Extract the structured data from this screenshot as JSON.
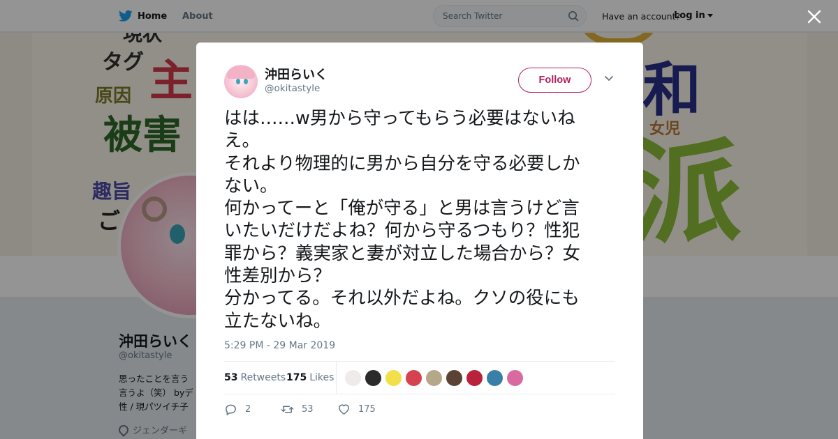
{
  "topbar": {
    "nav": {
      "home": "Home",
      "about": "About"
    },
    "search": {
      "placeholder": "Search Twitter"
    },
    "account_prompt": "Have an account?",
    "login_label": "Log in"
  },
  "banner_words": [
    "現状",
    "タグ",
    "主",
    "原因",
    "被害",
    "和",
    "女児",
    "派",
    "趣旨",
    "ご"
  ],
  "profile": {
    "name": "沖田らいく",
    "handle": "@okitastyle",
    "bio_lines": [
      "思ったことを言う",
      "言うよ（笑） byデ",
      "性 / 現パツイチ子"
    ],
    "location": "ジェンダーギ"
  },
  "tweet": {
    "author_name": "沖田らいく",
    "author_handle": "@okitastyle",
    "follow_label": "Follow",
    "text_lines": [
      "はは……w男から守ってもらう必要はないね",
      "え。",
      "それより物理的に男から自分を守る必要しか",
      "ない。",
      "何かってーと「俺が守る」と男は言うけど言",
      "いたいだけだよね？何から守るつもり？性犯",
      "罪から？義実家と妻が対立した場合から？女",
      "性差別から？",
      "分かってる。それ以外だよね。クソの役にも",
      "立たないね。"
    ],
    "timestamp": "5:29 PM - 29 Mar 2019",
    "retweets_count": "53",
    "retweets_label": "Retweets",
    "likes_count": "175",
    "likes_label": "Likes",
    "reply_count": "2",
    "retweet_action_count": "53",
    "like_action_count": "175"
  },
  "colors": {
    "accent": "#b0205e",
    "text": "#14171a",
    "secondary": "#657786",
    "liker_avatars": [
      "#f0eaea",
      "#2b2b2b",
      "#f2e04a",
      "#d4434f",
      "#b5a88a",
      "#5a4332",
      "#b8223a",
      "#3a7fa8",
      "#d96aa0"
    ]
  },
  "icons": {
    "logo": "twitter-bird-icon",
    "search": "search-icon",
    "close": "close-icon",
    "menu": "chevron-down-icon",
    "reply": "reply-icon",
    "retweet": "retweet-icon",
    "like": "heart-icon",
    "location": "location-pin-icon"
  }
}
